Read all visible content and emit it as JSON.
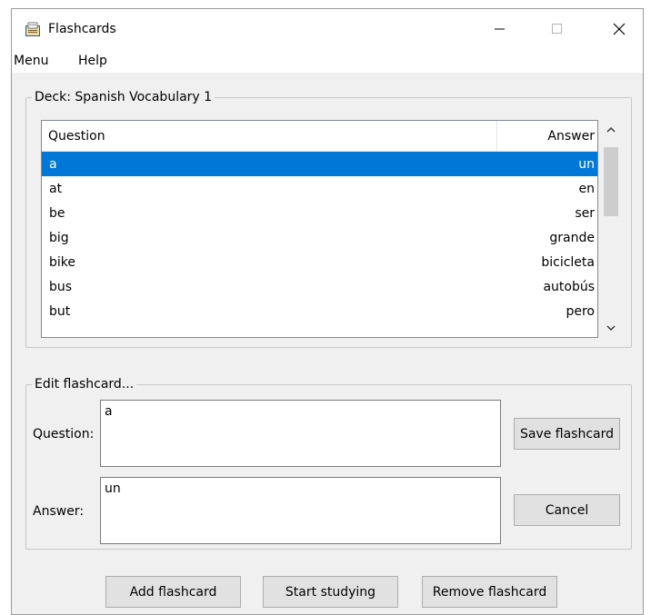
{
  "window": {
    "title": "Flashcards",
    "controls": {
      "minimize": "—",
      "maximize": "☐",
      "close": "✕"
    }
  },
  "menubar": {
    "items": [
      "Menu",
      "Help"
    ]
  },
  "deck": {
    "label": "Deck: Spanish Vocabulary 1",
    "columns": {
      "question": "Question",
      "answer": "Answer"
    },
    "rows": [
      {
        "question": "a",
        "answer": "un",
        "selected": true
      },
      {
        "question": "at",
        "answer": "en"
      },
      {
        "question": "be",
        "answer": "ser"
      },
      {
        "question": "big",
        "answer": "grande"
      },
      {
        "question": "bike",
        "answer": "bicicleta"
      },
      {
        "question": "bus",
        "answer": "autobús"
      },
      {
        "question": "but",
        "answer": "pero"
      }
    ]
  },
  "edit": {
    "label": "Edit flashcard...",
    "question_label": "Question:",
    "question_value": "a",
    "answer_label": "Answer:",
    "answer_value": "un",
    "save_label": "Save flashcard",
    "cancel_label": "Cancel"
  },
  "actions": {
    "add_label": "Add flashcard",
    "study_label": "Start studying",
    "remove_label": "Remove flashcard"
  },
  "colors": {
    "selection": "#0078d7",
    "window_bg": "#f0f0f0",
    "button_bg": "#e1e1e1"
  }
}
